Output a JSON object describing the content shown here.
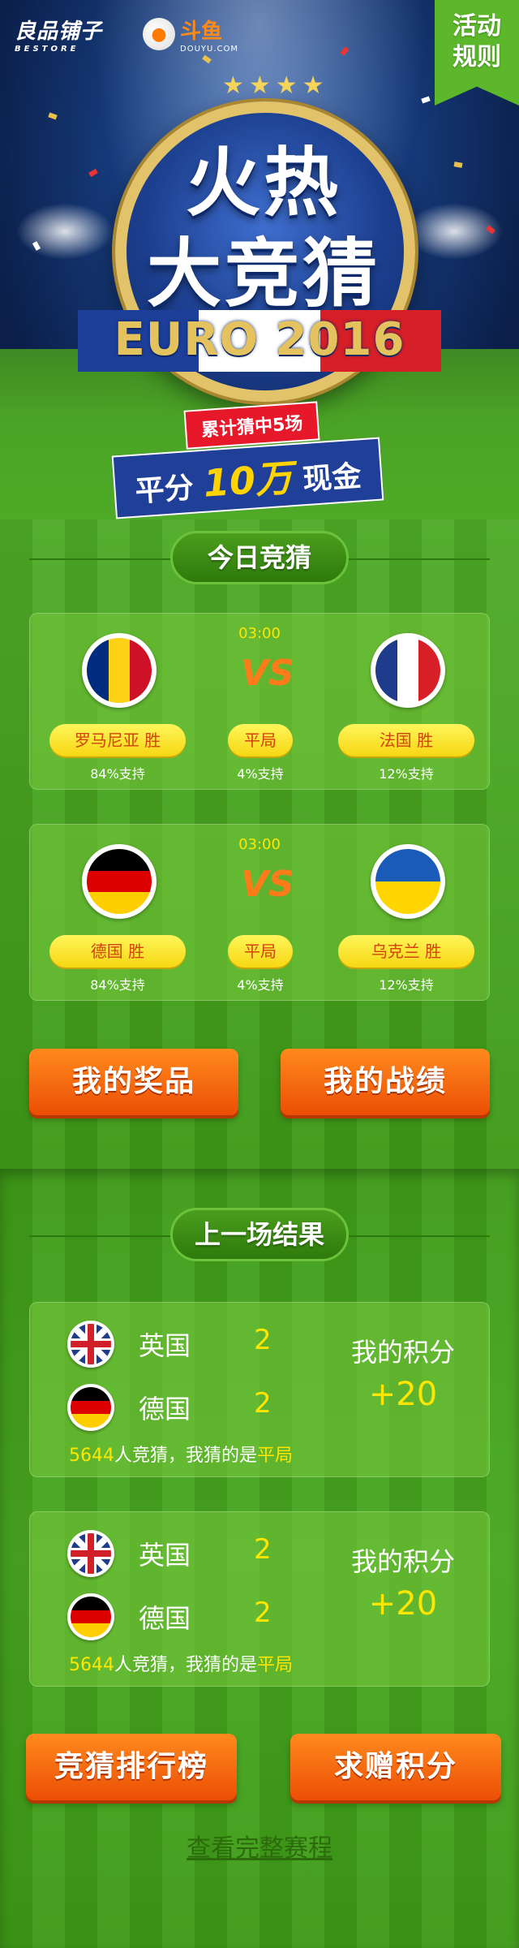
{
  "hero": {
    "brand_name": "良品铺子",
    "brand_sub": "BESTORE",
    "partner_name": "斗鱼",
    "partner_domain": "DOUYU.COM",
    "rules_line1": "活动",
    "rules_line2": "规则",
    "title_line1": "火热",
    "title_line2": "大竞猜",
    "event": "EURO 2016",
    "promo_tag": "累计猜中5场",
    "promo_cash_pre": "平分",
    "promo_cash_amount": "10万",
    "promo_cash_post": "现金"
  },
  "today": {
    "header": "今日竞猜",
    "matches": [
      {
        "time": "03:00",
        "vs": "VS",
        "home": {
          "flag": "romania-flag",
          "label": "罗马尼亚 胜",
          "support": "84%支持"
        },
        "draw": {
          "label": "平局",
          "support": "4%支持"
        },
        "away": {
          "flag": "france-flag",
          "label": "法国 胜",
          "support": "12%支持"
        }
      },
      {
        "time": "03:00",
        "vs": "VS",
        "home": {
          "flag": "germany-flag",
          "label": "德国 胜",
          "support": "84%支持"
        },
        "draw": {
          "label": "平局",
          "support": "4%支持"
        },
        "away": {
          "flag": "ukraine-flag",
          "label": "乌克兰 胜",
          "support": "12%支持"
        }
      }
    ],
    "btn_prizes": "我的奖品",
    "btn_record": "我的战绩"
  },
  "last": {
    "header": "上一场结果",
    "results": [
      {
        "team1": "英国",
        "score1": "2",
        "team2": "德国",
        "score2": "2",
        "points_label": "我的积分",
        "points": "+20",
        "count": "5644",
        "note_mid": "人竞猜，我猜的是",
        "guess": "平局"
      },
      {
        "team1": "英国",
        "score1": "2",
        "team2": "德国",
        "score2": "2",
        "points_label": "我的积分",
        "points": "+20",
        "count": "5644",
        "note_mid": "人竞猜，我猜的是",
        "guess": "平局"
      }
    ],
    "btn_rank": "竞猜排行榜",
    "btn_ask": "求赠积分",
    "full_schedule": "查看完整赛程"
  },
  "colors": {
    "grass": "#3e9a17",
    "accent_yellow": "#ffe600",
    "button_orange": "#ec4e05",
    "choice_text": "#d2420a"
  }
}
